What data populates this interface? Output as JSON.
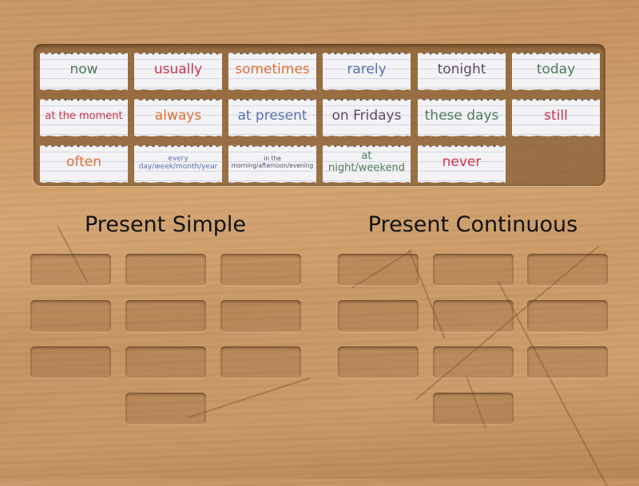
{
  "colors": {
    "green": "#4f7a5a",
    "red": "#d0324a",
    "orange": "#e0703a",
    "blue": "#5a72b0",
    "purple": "#5b4a66",
    "heading": "#111111"
  },
  "cards": [
    {
      "label": "now",
      "color": "green",
      "size": "big"
    },
    {
      "label": "usually",
      "color": "red",
      "size": "big"
    },
    {
      "label": "sometimes",
      "color": "orange",
      "size": "big"
    },
    {
      "label": "rarely",
      "color": "blue",
      "size": "big"
    },
    {
      "label": "tonight",
      "color": "purple",
      "size": "big"
    },
    {
      "label": "today",
      "color": "green",
      "size": "big"
    },
    {
      "label": "at the moment",
      "color": "red",
      "size": "mid"
    },
    {
      "label": "always",
      "color": "orange",
      "size": "big"
    },
    {
      "label": "at present",
      "color": "blue",
      "size": "big"
    },
    {
      "label": "on Fridays",
      "color": "purple",
      "size": "big"
    },
    {
      "label": "these days",
      "color": "green",
      "size": "big"
    },
    {
      "label": "still",
      "color": "red",
      "size": "big"
    },
    {
      "label": "often",
      "color": "orange",
      "size": "big"
    },
    {
      "label": "every day/week/month/year",
      "color": "blue",
      "size": "small"
    },
    {
      "label": "in the morning/afternoon/evening",
      "color": "purple",
      "size": "tiny"
    },
    {
      "label": "at night/weekend",
      "color": "green",
      "size": "mid"
    },
    {
      "label": "never",
      "color": "red",
      "size": "big"
    }
  ],
  "groups": [
    {
      "title": "Present Simple",
      "slots": 10
    },
    {
      "title": "Present Continuous",
      "slots": 10
    }
  ]
}
